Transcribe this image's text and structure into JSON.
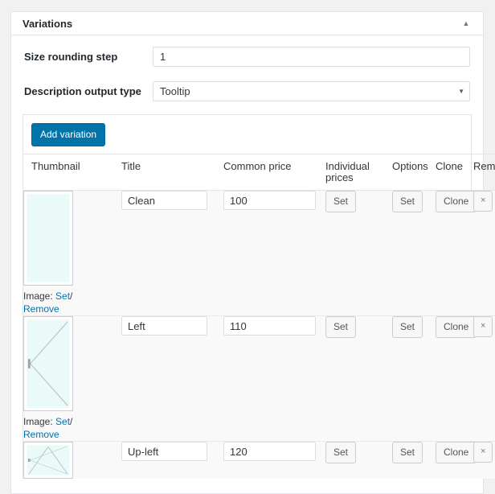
{
  "panel": {
    "title": "Variations",
    "toggle_icon": "chevron-up-icon"
  },
  "settings": [
    {
      "label": "Size rounding step",
      "type": "text",
      "value": "1"
    },
    {
      "label": "Description output type",
      "type": "select",
      "value": "Tooltip"
    }
  ],
  "toolbar": {
    "add_variation_label": "Add variation",
    "accent_color": "#0073aa"
  },
  "table": {
    "headers": {
      "thumbnail": "Thumbnail",
      "title": "Title",
      "common_price": "Common price",
      "individual_prices": "Individual prices",
      "options": "Options",
      "clone": "Clone",
      "remove": "Remove"
    },
    "image_label": "Image:",
    "image_set_label": "Set",
    "image_separator": "/",
    "image_remove_label": "Remove",
    "set_label": "Set",
    "clone_label": "Clone",
    "remove_label": "×",
    "rows": [
      {
        "title": "Clean",
        "common_price": "100",
        "thumbnail_type": "plain-window"
      },
      {
        "title": "Left",
        "common_price": "110",
        "thumbnail_type": "left-opening-window"
      },
      {
        "title": "Up-left",
        "common_price": "120",
        "thumbnail_type": "tilt-left-opening-window"
      }
    ]
  }
}
